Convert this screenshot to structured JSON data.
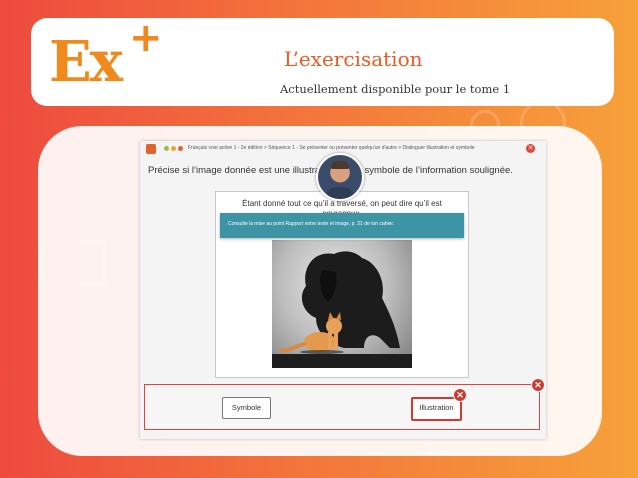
{
  "header": {
    "logo_text": "Ex",
    "logo_plus": "+",
    "title": "L’exercisation",
    "subtitle": "Actuellement disponible pour le tome 1"
  },
  "exercise_window": {
    "breadcrumb": "Français voie active 1 - 2e édition  >  Séquence 1 - Se présenter ou présenter quelqu'un d'autre  >  Distinguer illustration et symbole",
    "instruction": "Précise si l’image donnée est une illustration ou un symbole de l’information soulignée.",
    "question": "Étant donné tout ce qu’il a traversé, on peut dire qu’il est courageux.",
    "tooltip": "Consulte la mise au point Rapport entre texte et image, p. 21 de ton cahier.",
    "answers": [
      "Symbole",
      "Illustration"
    ],
    "selected_answer": "Illustration",
    "answer_status": "incorrect"
  },
  "icons": {
    "close": "close-icon",
    "wrong": "x-mark-icon",
    "avatar": "tutor-avatar"
  },
  "colors": {
    "brand_orange": "#f08a1d",
    "title_orange": "#ec5a26",
    "error_red": "#d23a30",
    "tooltip_teal": "#3d94a4"
  }
}
